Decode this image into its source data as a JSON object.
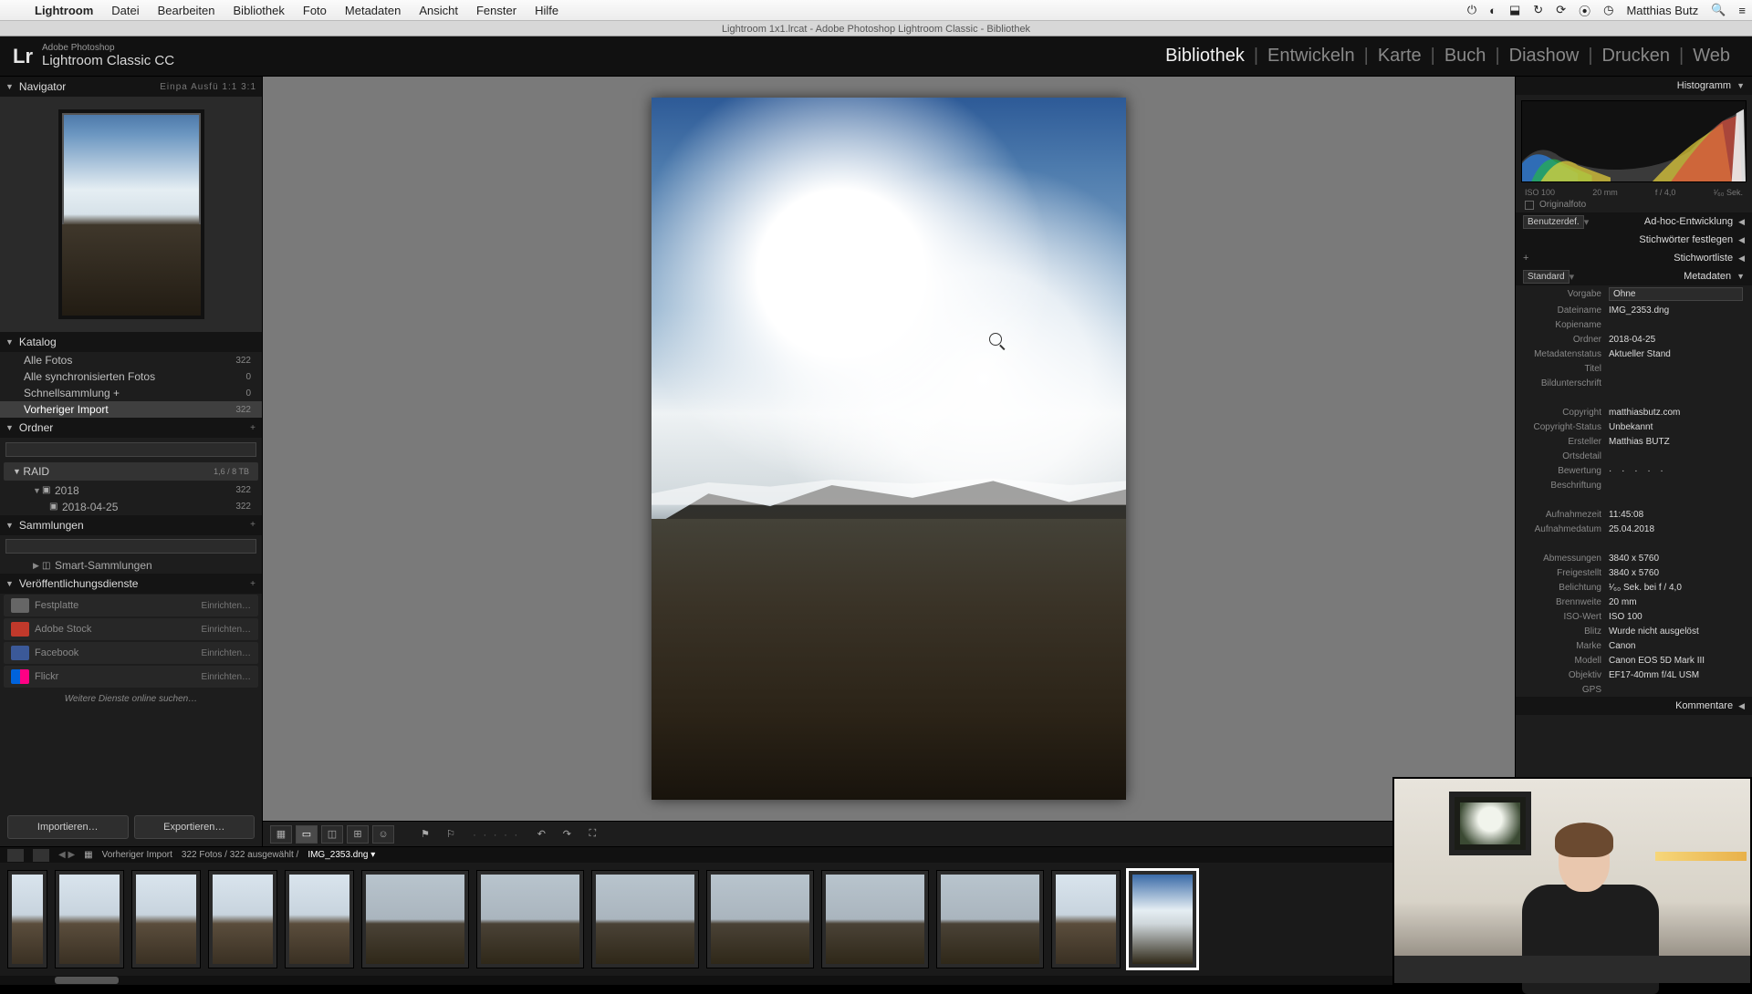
{
  "menubar": {
    "app": "Lightroom",
    "items": [
      "Datei",
      "Bearbeiten",
      "Bibliothek",
      "Foto",
      "Metadaten",
      "Ansicht",
      "Fenster",
      "Hilfe"
    ],
    "user": "Matthias Butz"
  },
  "docbar": "Lightroom 1x1.lrcat - Adobe Photoshop Lightroom Classic - Bibliothek",
  "brand": {
    "top": "Adobe Photoshop",
    "main": "Lightroom Classic CC",
    "logo": "Lr"
  },
  "modules": [
    "Bibliothek",
    "Entwickeln",
    "Karte",
    "Buch",
    "Diashow",
    "Drucken",
    "Web"
  ],
  "active_module": "Bibliothek",
  "left": {
    "navigator": {
      "title": "Navigator",
      "opts": "Einpa   Ausfü   1:1   3:1"
    },
    "katalog": {
      "title": "Katalog",
      "rows": [
        {
          "name": "Alle Fotos",
          "count": "322"
        },
        {
          "name": "Alle synchronisierten Fotos",
          "count": "0"
        },
        {
          "name": "Schnellsammlung  +",
          "count": "0"
        },
        {
          "name": "Vorheriger Import",
          "count": "322",
          "selected": true
        }
      ]
    },
    "ordner": {
      "title": "Ordner",
      "volume": {
        "name": "RAID",
        "meta": "1,6 / 8 TB"
      },
      "rows": [
        {
          "indent": 1,
          "name": "2018",
          "count": "322"
        },
        {
          "indent": 2,
          "name": "2018-04-25",
          "count": "322"
        }
      ]
    },
    "sammlungen": {
      "title": "Sammlungen",
      "smart": "Smart-Sammlungen"
    },
    "publish": {
      "title": "Veröffentlichungsdienste",
      "rows": [
        {
          "name": "Festplatte",
          "color": "#666"
        },
        {
          "name": "Adobe Stock",
          "color": "#c0392b"
        },
        {
          "name": "Facebook",
          "color": "#3b5998"
        },
        {
          "name": "Flickr",
          "color": "#ff0084"
        }
      ],
      "edit": "Einrichten…",
      "more": "Weitere Dienste online suchen…"
    },
    "import": "Importieren…",
    "export": "Exportieren…"
  },
  "right": {
    "histogram": "Histogramm",
    "histoinfo": {
      "iso": "ISO 100",
      "focal": "20 mm",
      "ap": "f / 4,0",
      "shut": "¹⁄₆₀ Sek."
    },
    "original": "Originalfoto",
    "panels": {
      "quickdev": "Ad-hoc-Entwicklung",
      "keywording": "Stichwörter festlegen",
      "keywordlist": "Stichwortliste",
      "metadata": "Metadaten",
      "comments": "Kommentare"
    },
    "preset_lbl": "Benutzerdef.",
    "meta_mode": "Standard",
    "meta": [
      {
        "lbl": "Vorgabe",
        "val": "Ohne",
        "dd": true
      },
      {
        "lbl": "Dateiname",
        "val": "IMG_2353.dng"
      },
      {
        "lbl": "Kopiename",
        "val": ""
      },
      {
        "lbl": "Ordner",
        "val": "2018-04-25"
      },
      {
        "lbl": "Metadatenstatus",
        "val": "Aktueller Stand"
      },
      {
        "lbl": "Titel",
        "val": ""
      },
      {
        "lbl": "Bildunterschrift",
        "val": ""
      },
      {
        "lbl": "",
        "val": ""
      },
      {
        "lbl": "Copyright",
        "val": "matthiasbutz.com"
      },
      {
        "lbl": "Copyright-Status",
        "val": "Unbekannt"
      },
      {
        "lbl": "Ersteller",
        "val": "Matthias BUTZ"
      },
      {
        "lbl": "Ortsdetail",
        "val": ""
      },
      {
        "lbl": "Bewertung",
        "val": "·  ·  ·  ·  ·",
        "stars": true
      },
      {
        "lbl": "Beschriftung",
        "val": ""
      },
      {
        "lbl": "",
        "val": ""
      },
      {
        "lbl": "Aufnahmezeit",
        "val": "11:45:08"
      },
      {
        "lbl": "Aufnahmedatum",
        "val": "25.04.2018"
      },
      {
        "lbl": "",
        "val": ""
      },
      {
        "lbl": "Abmessungen",
        "val": "3840 x 5760"
      },
      {
        "lbl": "Freigestellt",
        "val": "3840 x 5760"
      },
      {
        "lbl": "Belichtung",
        "val": "¹⁄₆₀ Sek. bei f / 4,0"
      },
      {
        "lbl": "Brennweite",
        "val": "20 mm"
      },
      {
        "lbl": "ISO-Wert",
        "val": "ISO 100"
      },
      {
        "lbl": "Blitz",
        "val": "Wurde nicht ausgelöst"
      },
      {
        "lbl": "Marke",
        "val": "Canon"
      },
      {
        "lbl": "Modell",
        "val": "Canon EOS 5D Mark III"
      },
      {
        "lbl": "Objektiv",
        "val": "EF17-40mm f/4L USM"
      },
      {
        "lbl": "GPS",
        "val": ""
      }
    ]
  },
  "filmstrip": {
    "info": {
      "src": "Vorheriger Import",
      "count": "322 Fotos / 322 ausgewählt /",
      "file": "IMG_2353.dng ▾"
    }
  }
}
